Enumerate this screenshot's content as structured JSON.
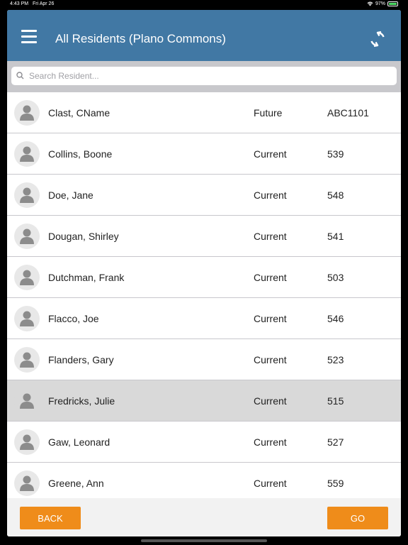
{
  "status_bar": {
    "time": "4:43 PM",
    "date": "Fri Apr 26",
    "battery": "97%"
  },
  "header": {
    "title": "All Residents (Plano Commons)",
    "menu_icon": "hamburger-menu-icon",
    "refresh_icon": "refresh-icon",
    "color": "#4178a4"
  },
  "search": {
    "placeholder": "Search Resident...",
    "value": ""
  },
  "residents": [
    {
      "name": "Clast, CName",
      "status": "Future",
      "unit": "ABC1101",
      "selected": false
    },
    {
      "name": "Collins, Boone",
      "status": "Current",
      "unit": "539",
      "selected": false
    },
    {
      "name": "Doe, Jane",
      "status": "Current",
      "unit": "548",
      "selected": false
    },
    {
      "name": "Dougan, Shirley",
      "status": "Current",
      "unit": "541",
      "selected": false
    },
    {
      "name": "Dutchman, Frank",
      "status": "Current",
      "unit": "503",
      "selected": false
    },
    {
      "name": "Flacco, Joe",
      "status": "Current",
      "unit": "546",
      "selected": false
    },
    {
      "name": "Flanders, Gary",
      "status": "Current",
      "unit": "523",
      "selected": false
    },
    {
      "name": "Fredricks, Julie",
      "status": "Current",
      "unit": "515",
      "selected": true
    },
    {
      "name": "Gaw, Leonard",
      "status": "Current",
      "unit": "527",
      "selected": false
    },
    {
      "name": "Greene, Ann",
      "status": "Current",
      "unit": "559",
      "selected": false
    }
  ],
  "footer": {
    "back_label": "BACK",
    "go_label": "GO",
    "button_color": "#ef8c1a"
  }
}
